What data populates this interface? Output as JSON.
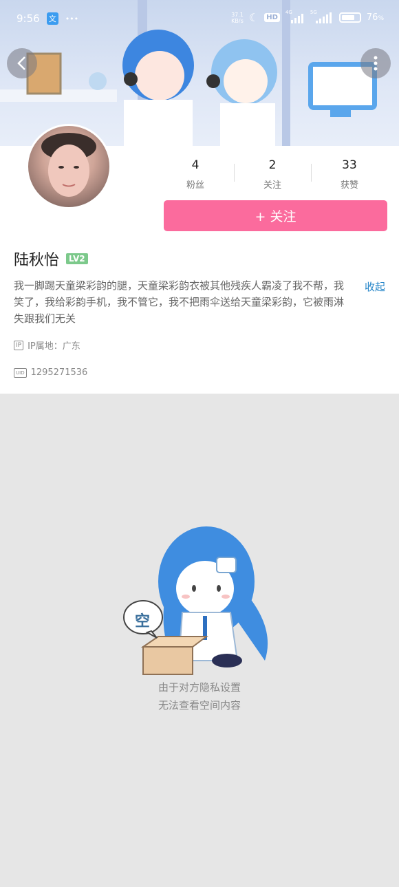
{
  "status_bar": {
    "time": "9:56",
    "app_icon": "文",
    "more": "•••",
    "net_speed_top": "37.1",
    "net_speed_bottom": "KB/s",
    "hd": "HD",
    "sim1": "4G",
    "sim2": "5G",
    "battery": "76",
    "battery_unit": "%",
    "battery_level": 0.76
  },
  "nav": {
    "back_icon": "chevron-left-icon",
    "more_icon": "more-vertical-icon"
  },
  "profile": {
    "stats": [
      {
        "value": "4",
        "label": "粉丝"
      },
      {
        "value": "2",
        "label": "关注"
      },
      {
        "value": "33",
        "label": "获赞"
      }
    ],
    "follow_button": "+ 关注",
    "name": "陆秋怡",
    "level": "LV2",
    "bio": "我一脚踢天童梁彩韵的腿，天童梁彩韵衣被其他残疾人霸凌了我不帮，我笑了，我给彩韵手机，我不管它，我不把雨伞送给天童梁彩韵，它被雨淋失跟我们无关",
    "collapse": "收起",
    "ip_icon_text": "IP",
    "ip_location": "IP属地：广东",
    "uid_icon_text": "UID",
    "uid": "1295271536"
  },
  "empty_state": {
    "bubble_char": "空",
    "line1": "由于对方隐私设置",
    "line2": "无法查看空间内容"
  },
  "colors": {
    "accent_pink": "#fb6b9d",
    "link_blue": "#2585c8",
    "level_green": "#7cc98b"
  }
}
